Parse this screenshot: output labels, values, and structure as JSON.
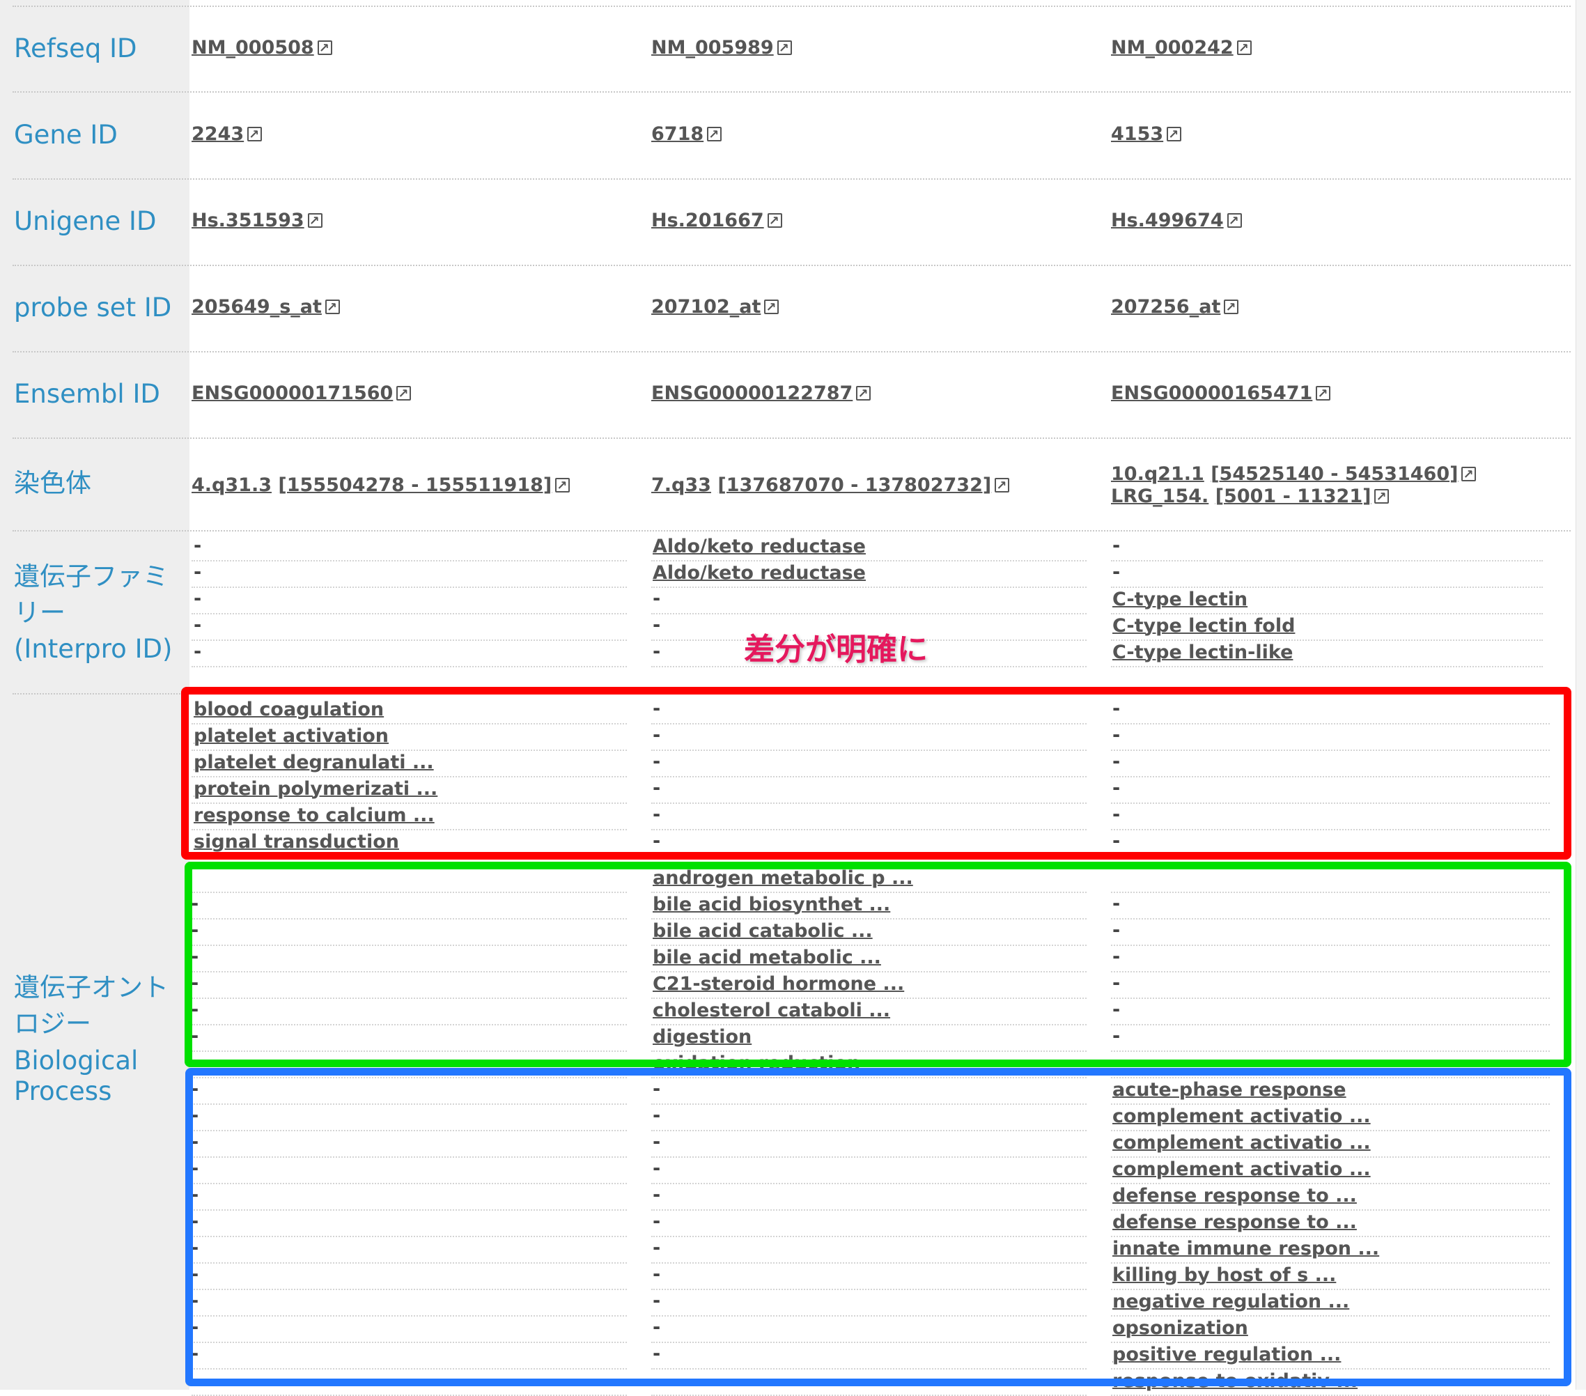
{
  "labels": {
    "refseq": "Refseq ID",
    "gene": "Gene ID",
    "unigene": "Unigene ID",
    "probe": "probe set ID",
    "ensembl": "Ensembl ID",
    "chromosome": "染色体",
    "family_l1": "遺伝子ファミ",
    "family_l2": "リー",
    "family_l3": "(Interpro ID)",
    "go_l1": "遺伝子オント",
    "go_l2": "ロジー",
    "go_l3": "Biological",
    "go_l4": "Process"
  },
  "genes": [
    {
      "refseq": "NM_000508",
      "gene": "2243",
      "unigene": "Hs.351593",
      "probe": "205649_s_at",
      "ensembl": "ENSG00000171560",
      "chrom": "4.q31.3",
      "range": "[155504278 - 155511918]"
    },
    {
      "refseq": "NM_005989",
      "gene": "6718",
      "unigene": "Hs.201667",
      "probe": "207102_at",
      "ensembl": "ENSG00000122787",
      "chrom": "7.q33",
      "range": "[137687070 - 137802732]"
    },
    {
      "refseq": "NM_000242",
      "gene": "4153",
      "unigene": "Hs.499674",
      "probe": "207256_at",
      "ensembl": "ENSG00000165471",
      "chrom": "10.q21.1",
      "range": "[54525140 - 54531460]",
      "chrom2": "LRG_154.",
      "range2": "[5001 - 11321]"
    }
  ],
  "family": {
    "col1": [
      "-",
      "-",
      "-",
      "-",
      "-"
    ],
    "col2": [
      "Aldo/keto reductase",
      "Aldo/keto reductase",
      "-",
      "-",
      "-"
    ],
    "col3": [
      "-",
      "-",
      "C-type lectin",
      "C-type lectin fold",
      "C-type lectin-like"
    ]
  },
  "annotation": "差分が明確に",
  "go_red": {
    "col1": [
      "blood coagulation",
      "platelet activation",
      "platelet degranulati ...",
      "protein polymerizati ...",
      "response to calcium ...",
      "signal transduction"
    ]
  },
  "go_green": {
    "col2": [
      "androgen metabolic p ...",
      "bile acid biosynthet ...",
      "bile acid catabolic ...",
      "bile acid metabolic ...",
      "C21-steroid hormone ...",
      "cholesterol cataboli ...",
      "digestion",
      "oxidation reduction"
    ]
  },
  "go_blue": {
    "col3": [
      "acute-phase response",
      "complement activatio ...",
      "complement activatio ...",
      "complement activatio ...",
      "defense response to ...",
      "defense response to ...",
      "innate immune respon ...",
      "killing by host of s ...",
      "negative regulation ...",
      "opsonization",
      "positive regulation ...",
      "response to oxidativ ..."
    ]
  },
  "dash": "-",
  "colors": {
    "label": "#2f8fc3",
    "red": "#ff0000",
    "green": "#00e000",
    "blue": "#2277ff",
    "annot": "#e5185d"
  }
}
